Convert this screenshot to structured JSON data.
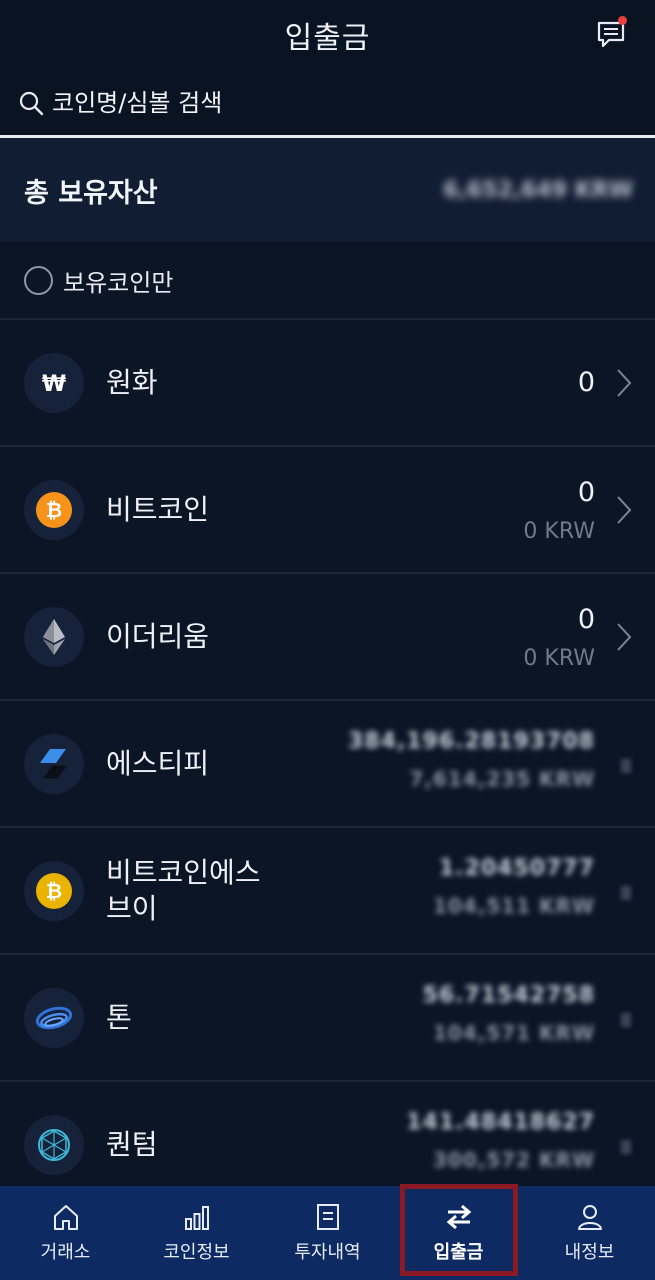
{
  "header": {
    "title": "입출금",
    "chat_icon": "chat-icon",
    "has_notification": true
  },
  "search": {
    "placeholder": "코인명/심볼 검색",
    "value": ""
  },
  "total_assets": {
    "label": "총 보유자산",
    "value": "6,652,649 KRW"
  },
  "filter": {
    "label": "보유코인만",
    "checked": false
  },
  "coins": [
    {
      "name": "원화",
      "icon": "won-icon",
      "amount": "0",
      "krw": "",
      "blurred": false
    },
    {
      "name": "비트코인",
      "icon": "bitcoin-icon",
      "amount": "0",
      "krw": "0 KRW",
      "blurred": false
    },
    {
      "name": "이더리움",
      "icon": "ethereum-icon",
      "amount": "0",
      "krw": "0 KRW",
      "blurred": false
    },
    {
      "name": "에스티피",
      "icon": "stp-icon",
      "amount": "384,196.28193708",
      "krw": "7,614,235 KRW",
      "blurred": true
    },
    {
      "name": "비트코인에스\n브이",
      "icon": "bitcoin-sv-icon",
      "amount": "1.20450777",
      "krw": "104,511 KRW",
      "blurred": true
    },
    {
      "name": "톤",
      "icon": "ton-icon",
      "amount": "56.71542758",
      "krw": "104,571 KRW",
      "blurred": true
    },
    {
      "name": "퀀텀",
      "icon": "qtum-icon",
      "amount": "141.48418627",
      "krw": "300,572 KRW",
      "blurred": true
    }
  ],
  "bottom_nav": [
    {
      "label": "거래소",
      "icon": "home-icon",
      "active": false
    },
    {
      "label": "코인정보",
      "icon": "bar-chart-icon",
      "active": false
    },
    {
      "label": "투자내역",
      "icon": "document-icon",
      "active": false
    },
    {
      "label": "입출금",
      "icon": "transfer-icon",
      "active": true
    },
    {
      "label": "내정보",
      "icon": "user-icon",
      "active": false
    }
  ],
  "colors": {
    "background": "#0b1526",
    "accent_nav": "#0e2a63",
    "highlight_frame": "#8b1a24",
    "bitcoin": "#f7931a",
    "bitcoin_sv": "#eab300"
  }
}
